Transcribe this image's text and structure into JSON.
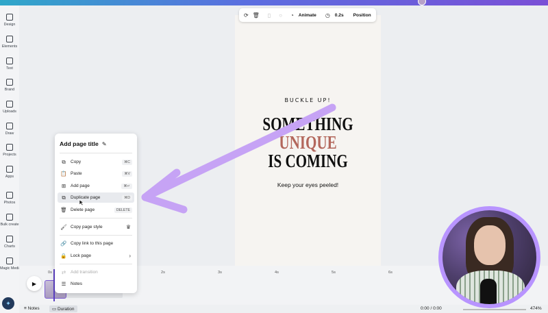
{
  "sidebar": {
    "items": [
      {
        "label": "Design",
        "icon": "design-icon"
      },
      {
        "label": "Elements",
        "icon": "elements-icon"
      },
      {
        "label": "Text",
        "icon": "text-icon"
      },
      {
        "label": "Brand",
        "icon": "brand-icon"
      },
      {
        "label": "Uploads",
        "icon": "uploads-icon"
      },
      {
        "label": "Draw",
        "icon": "draw-icon"
      },
      {
        "label": "Projects",
        "icon": "projects-icon"
      },
      {
        "label": "Apps",
        "icon": "apps-icon"
      },
      {
        "label": "Photos",
        "icon": "photos-icon"
      },
      {
        "label": "Bulk create",
        "icon": "bulk-create-icon"
      },
      {
        "label": "Charts",
        "icon": "charts-icon"
      },
      {
        "label": "Magic Media",
        "icon": "magic-media-icon"
      }
    ]
  },
  "toolbar": {
    "animate_label": "Animate",
    "duration_label": "0.2s",
    "position_label": "Position"
  },
  "design": {
    "top_text": "BUCKLE UP!",
    "line1": "SOMETHING",
    "line2": "UNIQUE",
    "line3": "IS COMING",
    "subtext": "Keep your eyes peeled!",
    "accent_color": "#b3675c"
  },
  "context_menu": {
    "title": "Add page title",
    "items": [
      {
        "label": "Copy",
        "shortcut": "⌘C",
        "icon": "copy-icon"
      },
      {
        "label": "Paste",
        "shortcut": "⌘V",
        "icon": "paste-icon"
      },
      {
        "label": "Add page",
        "shortcut": "⌘↵",
        "icon": "add-page-icon"
      },
      {
        "label": "Duplicate page",
        "shortcut": "⌘D",
        "icon": "duplicate-page-icon"
      },
      {
        "label": "Delete page",
        "shortcut": "DELETE",
        "icon": "trash-icon"
      },
      {
        "label": "Copy page style",
        "shortcut": "",
        "icon": "paint-roller-icon"
      },
      {
        "label": "Copy link to this page",
        "shortcut": "",
        "icon": "link-icon"
      },
      {
        "label": "Lock page",
        "shortcut": "",
        "icon": "lock-icon"
      },
      {
        "label": "Add transition",
        "shortcut": "",
        "icon": "transition-icon"
      },
      {
        "label": "Notes",
        "shortcut": "",
        "icon": "notes-icon"
      }
    ]
  },
  "timeline": {
    "ticks": [
      "0s",
      "2s",
      "3s",
      "4s",
      "5s",
      "6s"
    ]
  },
  "bottombar": {
    "notes_label": "Notes",
    "duration_label": "Duration",
    "time": "0:00 / 0:00",
    "zoom": "474%"
  },
  "colors": {
    "arrow": "#c6a3f5",
    "webcam_ring": "#b894ff",
    "brand_gradient_start": "#2fa7c9",
    "brand_gradient_end": "#7a4fd6"
  }
}
